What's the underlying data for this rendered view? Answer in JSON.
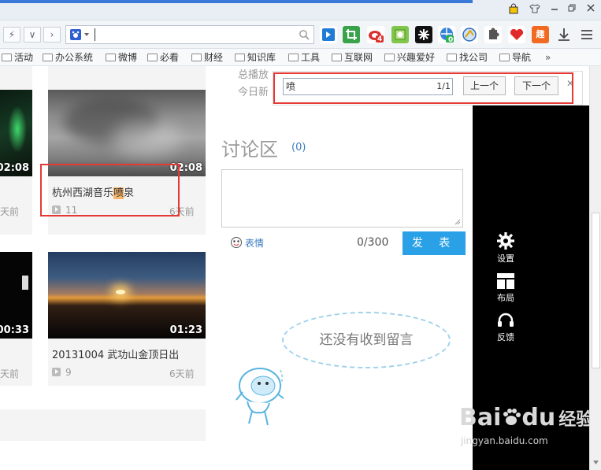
{
  "toolbar": {
    "back": "⚡",
    "dropdown": "∨",
    "forward": "›",
    "address_value": ""
  },
  "extensions": {
    "weibo_badge": "4",
    "cloud_badge": "0",
    "app_label": "趣"
  },
  "bookmarks": [
    "活动",
    "办公系统",
    "微博",
    "必看",
    "财经",
    "知识库",
    "工具",
    "互联网",
    "兴趣爱好",
    "找公司",
    "导航"
  ],
  "bookmarks_more": "»",
  "find_bar": {
    "query": "喷",
    "count": "1/1",
    "prev": "上一个",
    "next": "下一个",
    "close": "✕"
  },
  "background_text": {
    "line1": "总播放",
    "line2": "今日新"
  },
  "videos": [
    {
      "duration": "02:08",
      "meta_time": "天前"
    },
    {
      "title_pre": "杭州西湖音乐",
      "title_hl": "喷",
      "title_post": "泉",
      "duration": "02:08",
      "plays": "11",
      "time": "6天前"
    },
    {
      "duration": "00:33",
      "meta_time": "天前"
    },
    {
      "title": "20131004 武功山金顶日出",
      "duration": "01:23",
      "plays": "9",
      "time": "6天前"
    }
  ],
  "discussion": {
    "title": "讨论区",
    "count": "(0)",
    "emoji_label": "表情",
    "char_count": "0/300",
    "publish": "发 表",
    "empty_message": "还没有收到留言"
  },
  "sidepanel": {
    "settings": "设置",
    "layout": "布局",
    "feedback": "反馈"
  },
  "watermark": {
    "brand": "Bai",
    "brand2": "du",
    "cn": "经验",
    "url": "jingyan.baidu.com"
  }
}
